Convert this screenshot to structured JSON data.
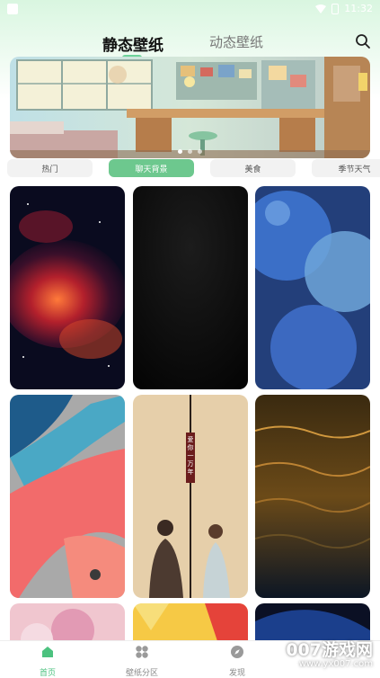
{
  "status_bar": {
    "time": "11:32"
  },
  "header": {
    "tabs": [
      {
        "label": "静态壁纸",
        "active": true
      },
      {
        "label": "动态壁纸",
        "active": false
      }
    ],
    "search_icon": "search-icon"
  },
  "categories": [
    {
      "label": "热门",
      "active": false
    },
    {
      "label": "聊天背景",
      "active": true
    },
    {
      "label": "美食",
      "active": false
    },
    {
      "label": "季节天气",
      "active": false
    }
  ],
  "wallpaper_tiles": [
    {
      "subject": "red nebula space"
    },
    {
      "subject": "black gradient"
    },
    {
      "subject": "blue spheres"
    },
    {
      "subject": "abstract red blue brush"
    },
    {
      "subject": "couple with vertical text",
      "overlay_text": "爱你一万年"
    },
    {
      "subject": "golden sea waves"
    },
    {
      "subject": "pink soft shapes"
    },
    {
      "subject": "yellow red pattern"
    },
    {
      "subject": "dark blue curve"
    }
  ],
  "bottom_nav": [
    {
      "label": "首页",
      "icon": "home-icon",
      "active": true
    },
    {
      "label": "壁纸分区",
      "icon": "grid-icon",
      "active": false
    },
    {
      "label": "发现",
      "icon": "compass-icon",
      "active": false
    }
  ],
  "watermark": {
    "brand": "007游戏网",
    "url": "www.yx007.com"
  },
  "colors": {
    "accent": "#4cc27f",
    "pill_active": "#6dc88e"
  }
}
